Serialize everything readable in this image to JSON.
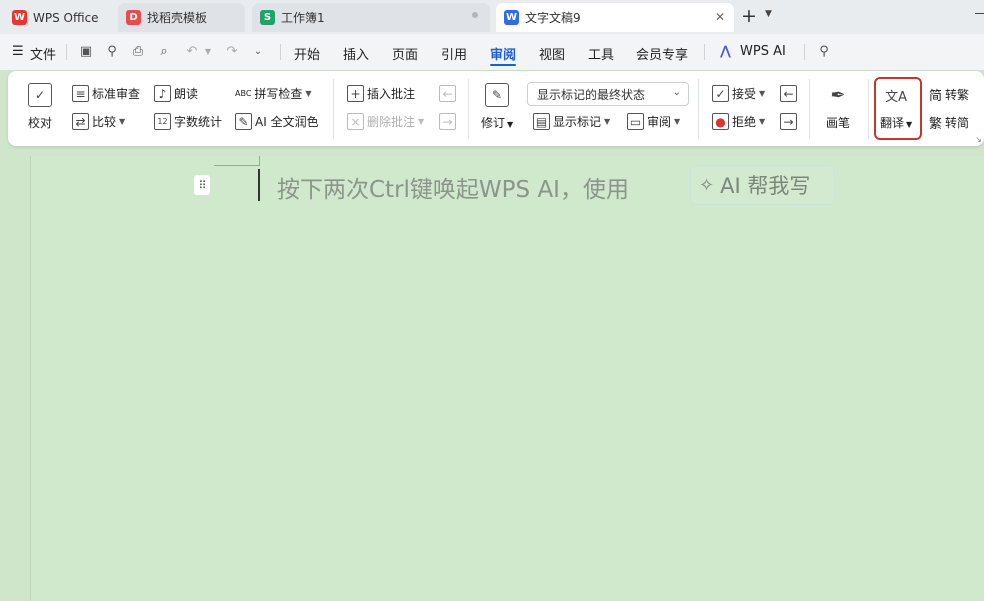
{
  "tabs": [
    {
      "label": "WPS Office",
      "icon": "wps-logo-icon",
      "color": "#e8362c"
    },
    {
      "label": "找稻壳模板",
      "icon": "docer-icon",
      "color": "#e84c4c"
    },
    {
      "label": "工作簿1",
      "icon": "spreadsheet-icon",
      "color": "#21a366"
    },
    {
      "label": "文字文稿9",
      "icon": "writer-icon",
      "color": "#2e6be6"
    }
  ],
  "menu": {
    "file": "文件",
    "items": [
      "开始",
      "插入",
      "页面",
      "引用",
      "审阅",
      "视图",
      "工具",
      "会员专享"
    ],
    "active": "审阅",
    "wps_ai": "WPS AI"
  },
  "ribbon": {
    "proofread": "校对",
    "standard_review": "标准审查",
    "read_aloud": "朗读",
    "spell_check": "拼写检查",
    "compare": "比较",
    "word_count": "字数统计",
    "ai_polish": "AI 全文润色",
    "insert_comment": "插入批注",
    "delete_comment": "删除批注",
    "track_changes": "修订",
    "markup_state": "显示标记的最终状态",
    "show_markup": "显示标记",
    "review": "审阅",
    "accept": "接受",
    "reject": "拒绝",
    "pen": "画笔",
    "translate": "翻译",
    "to_traditional": "转繁",
    "to_simplified": "转简",
    "abc_label": "ABC",
    "count_label": "12"
  },
  "document": {
    "hint": "按下两次Ctrl键唤起WPS AI，使用",
    "ai_chip": "AI 帮我写"
  },
  "colors": {
    "accent": "#1f5fd6",
    "doc_bg": "#d0e8cc",
    "highlight": "#c0392b"
  }
}
